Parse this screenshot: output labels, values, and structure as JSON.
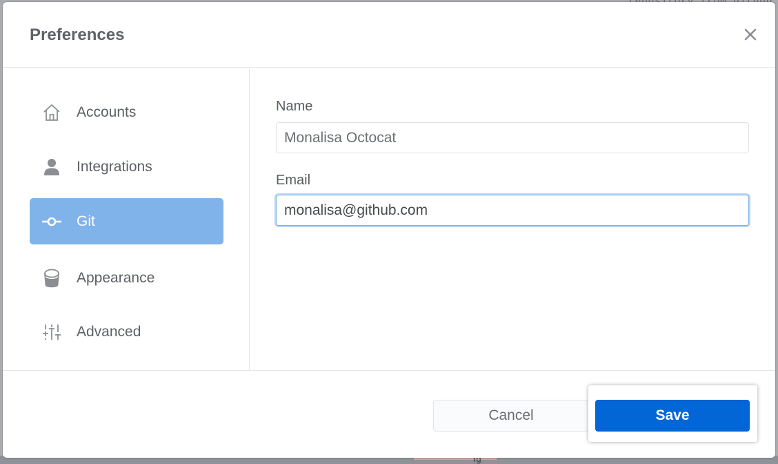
{
  "background": {
    "top_text": "repository from github",
    "bottom_text": "rg"
  },
  "dialog": {
    "title": "Preferences",
    "close_icon": "close-icon"
  },
  "sidebar": {
    "items": [
      {
        "label": "Accounts",
        "icon": "home-icon",
        "active": false
      },
      {
        "label": "Integrations",
        "icon": "person-icon",
        "active": false
      },
      {
        "label": "Git",
        "icon": "git-commit-icon",
        "active": true
      },
      {
        "label": "Appearance",
        "icon": "paintcan-icon",
        "active": false
      },
      {
        "label": "Advanced",
        "icon": "settings-sliders-icon",
        "active": false
      }
    ]
  },
  "form": {
    "name_label": "Name",
    "name_value": "Monalisa Octocat",
    "email_label": "Email",
    "email_value": "monalisa@github.com"
  },
  "footer": {
    "cancel_label": "Cancel",
    "save_label": "Save"
  },
  "colors": {
    "accent_active_nav": "#7fb3ea",
    "primary_button": "#0366d6",
    "title_text": "#606468"
  }
}
